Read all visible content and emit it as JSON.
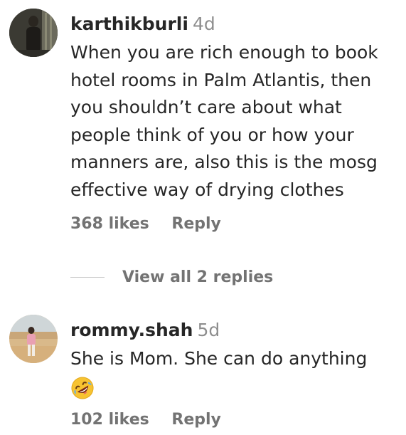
{
  "comments": [
    {
      "username": "karthikburli",
      "time": "4d",
      "lines": [
        "When you are rich enough to book",
        "hotel rooms in Palm Atlantis, then",
        "you shouldn’t care about what",
        "people think of you or how your",
        "manners are, also this is the mosg",
        "effective way of drying clothes"
      ],
      "likes": "368 likes",
      "reply": "Reply",
      "view_replies": "View all 2 replies"
    },
    {
      "username": "rommy.shah",
      "time": "5d",
      "lines": [
        "She is Mom. She can do anything"
      ],
      "emoji": "rolling-on-floor-laughing-emoji",
      "likes": "102 likes",
      "reply": "Reply"
    }
  ],
  "colors": {
    "text": "#262626",
    "secondary": "#8e8e8e",
    "action": "#737373"
  }
}
